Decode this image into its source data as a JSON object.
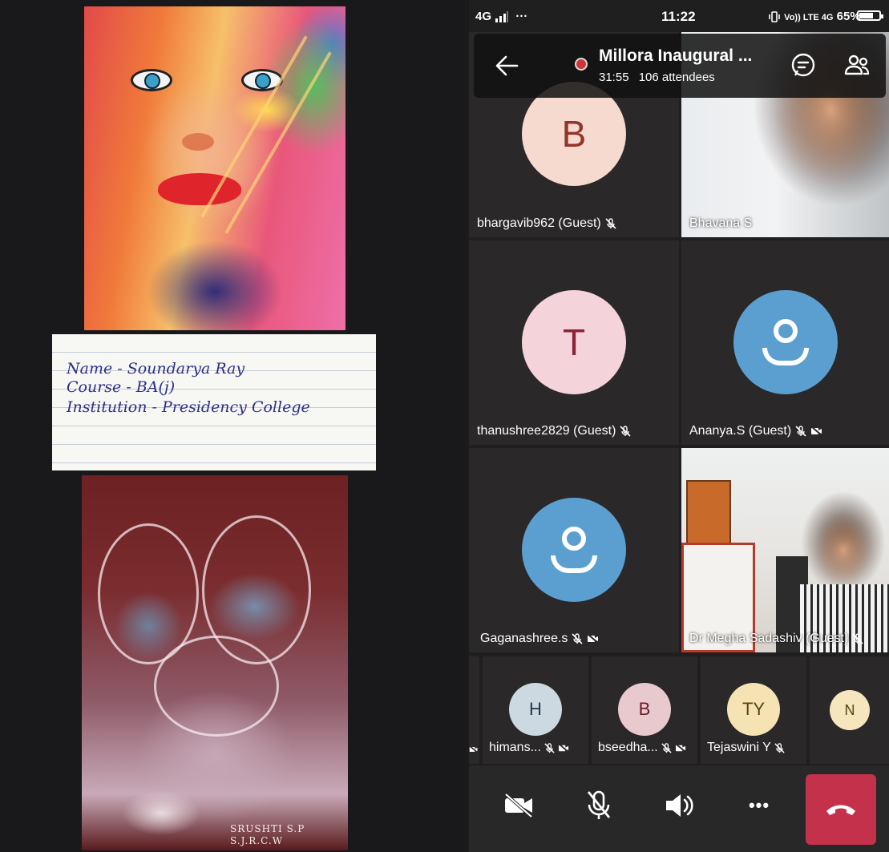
{
  "artwork": {
    "note_lines": [
      "Name - Soundarya Ray",
      "Course - BA(j)",
      "Institution - Presidency College"
    ],
    "signature_lines": [
      "SRUSHTI S.P",
      "S.J.R.C.W"
    ]
  },
  "status_bar": {
    "network_left": "4G",
    "dots": "···",
    "time": "11:22",
    "network_right": "Vo)) LTE 4G",
    "battery": "65%"
  },
  "meeting": {
    "title": "Millora Inaugural ...",
    "duration": "31:55",
    "attendees": "106 attendees"
  },
  "participants": [
    {
      "name": "bhargavib962 (Guest)",
      "initial": "B",
      "avatar_bg": "#f6d9cf",
      "avatar_fg": "#93342a",
      "muted": true
    },
    {
      "name": "Bhavana S",
      "video": true
    },
    {
      "name": "thanushree2829 (Guest)",
      "initial": "T",
      "avatar_bg": "#f5d3da",
      "avatar_fg": "#8a2537",
      "muted": true
    },
    {
      "name": "Ananya.S (Guest)",
      "generic_avatar": true,
      "muted": true,
      "camera_off": true
    },
    {
      "name": "Gaganashree.s",
      "generic_avatar": true,
      "muted": true,
      "camera_off": true
    },
    {
      "name": "Dr Megha Sadashiv (Guest)",
      "video": true,
      "muted": true
    }
  ],
  "small_participants": [
    {
      "name": "himans...",
      "initial": "H",
      "avatar_bg": "#cdd9e0",
      "avatar_fg": "#21384a"
    },
    {
      "name": "bseedha...",
      "initial": "B",
      "avatar_bg": "#e8c9cd",
      "avatar_fg": "#6a1c25"
    },
    {
      "name": "Tejaswini Y",
      "initial": "TY",
      "avatar_bg": "#f6e3b4",
      "avatar_fg": "#5a4210"
    },
    {
      "name": "",
      "initial": "N",
      "avatar_bg": "#f6e6bd",
      "avatar_fg": "#5a4210"
    }
  ],
  "controls": {
    "more": "•••"
  },
  "colors": {
    "hangup": "#c4314b",
    "recording": "#d13438",
    "generic_avatar": "#5b9fd0"
  }
}
